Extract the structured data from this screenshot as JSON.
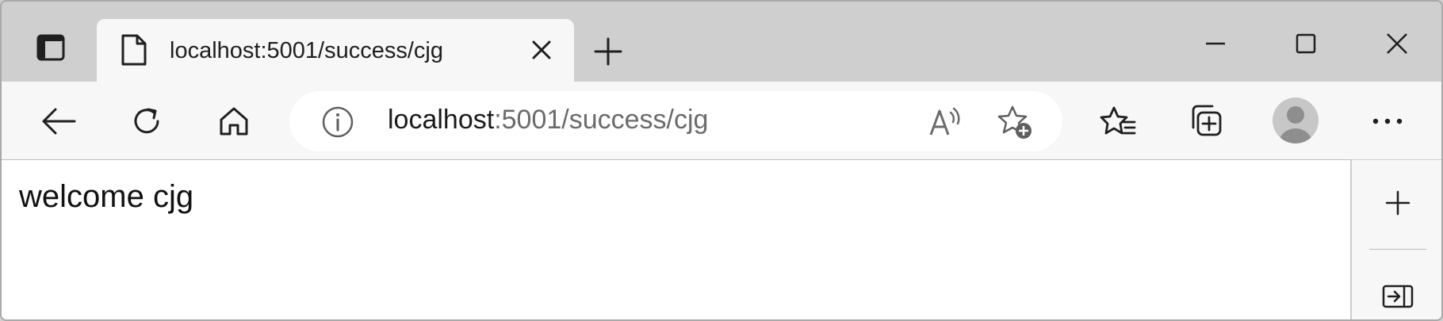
{
  "tab": {
    "title": "localhost:5001/success/cjg"
  },
  "address_bar": {
    "url_host": "localhost",
    "url_rest": ":5001/success/cjg"
  },
  "page": {
    "body_text": "welcome cjg"
  },
  "icons": {
    "tab_actions": "tab-actions-icon",
    "favicon": "page-icon",
    "close_tab": "close-icon",
    "new_tab": "plus-icon",
    "minimize": "minimize-icon",
    "maximize": "maximize-icon",
    "close_window": "close-icon",
    "back": "back-arrow-icon",
    "refresh": "refresh-icon",
    "home": "home-icon",
    "site_info": "info-icon",
    "read_aloud": "read-aloud-icon",
    "add_favorite": "add-favorite-icon",
    "favorites": "favorites-icon",
    "collections": "collections-icon",
    "profile": "profile-icon",
    "more": "more-icon",
    "sidebar_add": "plus-icon",
    "hide_sidebar": "hide-sidebar-icon"
  }
}
